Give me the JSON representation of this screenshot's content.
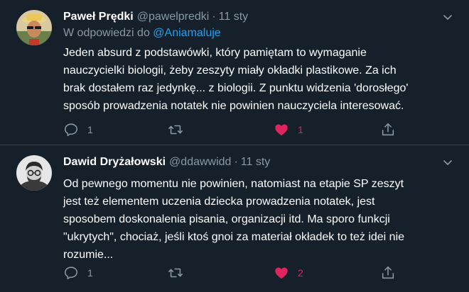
{
  "tweets": [
    {
      "display_name": "Paweł Prędki",
      "handle": "@pawelpredki",
      "separator": "·",
      "date": "11 sty",
      "reply_prefix": "W odpowiedzi do",
      "reply_mention": "@Aniamaluje",
      "text": "Jeden absurd z podstawówki, który pamiętam to wymaganie\nnauczycielki biologii, żeby zeszyty miały okładki plastikowe. Za ich\nbrak dostałem raz jedynkę... z biologii. Z punktu widzenia 'dorosłego'\nsposób prowadzenia notatek nie powinien nauczyciela interesować.",
      "reply_count": "1",
      "retweet_count": "",
      "like_count": "1",
      "liked": true
    },
    {
      "display_name": "Dawid Dryżałowski",
      "handle": "@ddawwidd",
      "separator": "·",
      "date": "11 sty",
      "text": "Od pewnego momentu nie powinien, natomiast na etapie SP zeszyt\njest też elementem uczenia dziecka prowadzenia notatek, jest\nsposobem doskonalenia pisania, organizacji itd. Ma sporo funkcji\n\"ukrytych\", chociaż, jeśli ktoś gnoi za materiał okładek to też idei nie\nrozumie...",
      "reply_count": "1",
      "retweet_count": "",
      "like_count": "2",
      "liked": true
    }
  ],
  "icons": {
    "reply": "reply-icon",
    "retweet": "retweet-icon",
    "like": "heart-icon",
    "share": "share-icon",
    "more": "chevron-down-icon"
  },
  "colors": {
    "background": "#15202b",
    "secondary_text": "#8899a6",
    "link": "#1da1f2",
    "like": "#e0245e",
    "divider": "#38444d"
  }
}
